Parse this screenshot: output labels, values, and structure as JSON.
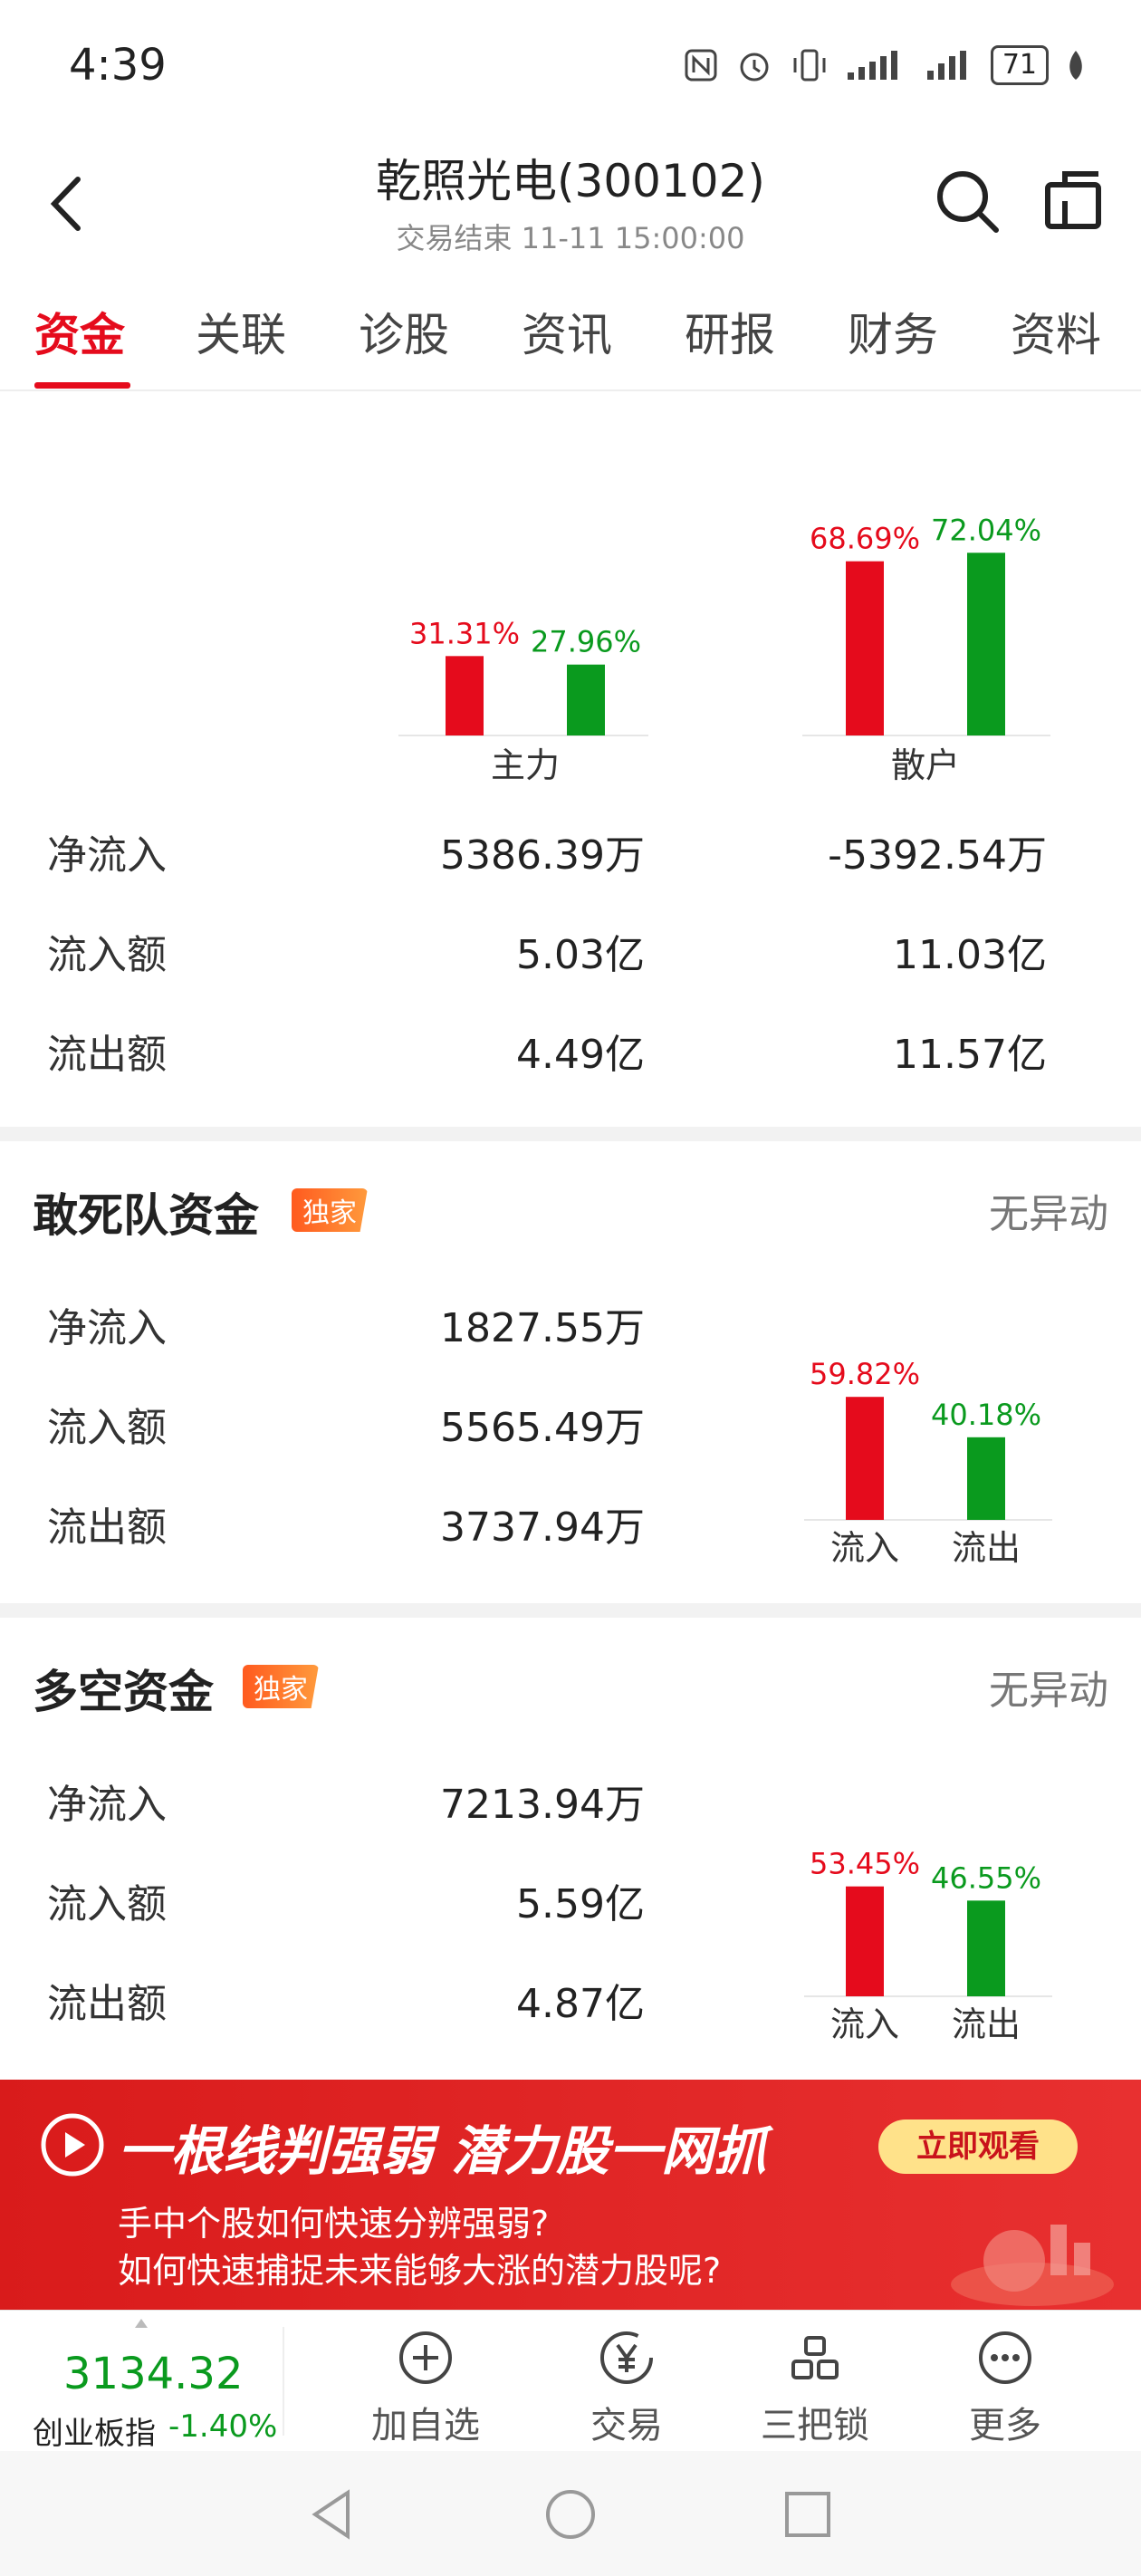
{
  "status_bar": {
    "time": "4:39",
    "battery": "71"
  },
  "header": {
    "title": "乾照光电(300102)",
    "subtitle": "交易结束 11-11 15:00:00"
  },
  "tabs": [
    "资金",
    "关联",
    "诊股",
    "资讯",
    "研报",
    "财务",
    "资料"
  ],
  "fund_flow": {
    "groups": [
      {
        "label": "主力",
        "in_pct": "31.31%",
        "out_pct": "27.96%"
      },
      {
        "label": "散户",
        "in_pct": "68.69%",
        "out_pct": "72.04%"
      }
    ],
    "rows": [
      {
        "label": "净流入",
        "main": "5386.39万",
        "retail": "-5392.54万"
      },
      {
        "label": "流入额",
        "main": "5.03亿",
        "retail": "11.03亿"
      },
      {
        "label": "流出额",
        "main": "4.49亿",
        "retail": "11.57亿"
      }
    ]
  },
  "chart_data": {
    "type": "bar",
    "categories": [
      "主力",
      "散户",
      "敢死队资金",
      "多空资金"
    ],
    "series": [
      {
        "name": "流入",
        "values": [
          31.31,
          68.69,
          59.82,
          53.45
        ]
      },
      {
        "name": "流出",
        "values": [
          27.96,
          72.04,
          40.18,
          46.55
        ]
      }
    ],
    "colors": {
      "in": "#e50b1c",
      "out": "#0a9a1e"
    }
  },
  "dare_team": {
    "title": "敢死队资金",
    "badge": "独家",
    "status": "无异动",
    "rows": [
      {
        "label": "净流入",
        "value": "1827.55万"
      },
      {
        "label": "流入额",
        "value": "5565.49万"
      },
      {
        "label": "流出额",
        "value": "3737.94万"
      }
    ],
    "in_pct": "59.82%",
    "out_pct": "40.18%",
    "in_label": "流入",
    "out_label": "流出"
  },
  "long_short": {
    "title": "多空资金",
    "badge": "独家",
    "status": "无异动",
    "rows": [
      {
        "label": "净流入",
        "value": "7213.94万"
      },
      {
        "label": "流入额",
        "value": "5.59亿"
      },
      {
        "label": "流出额",
        "value": "4.87亿"
      }
    ],
    "in_pct": "53.45%",
    "out_pct": "46.55%",
    "in_label": "流入",
    "out_label": "流出"
  },
  "banner": {
    "headline": "一根线判强弱 潜力股一网抓",
    "button": "立即观看",
    "line1": "手中个股如何快速分辨强弱?",
    "line2": "如何快速捕捉未来能够大涨的潜力股呢?"
  },
  "bottom": {
    "index_value": "3134.32",
    "index_name": "创业板指",
    "index_change": "-1.40%",
    "nav": [
      "加自选",
      "交易",
      "三把锁",
      "更多"
    ]
  }
}
